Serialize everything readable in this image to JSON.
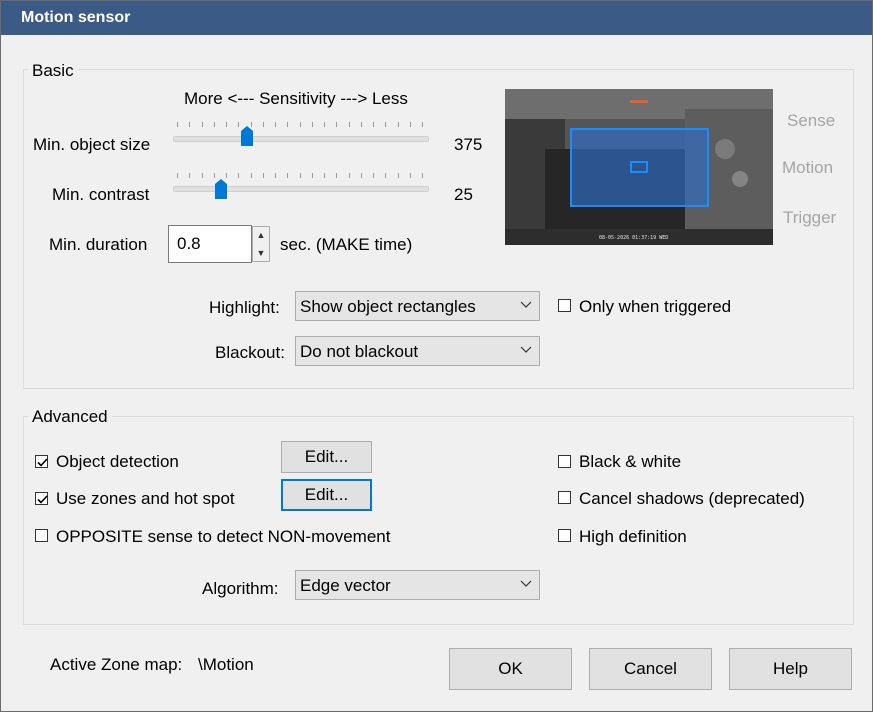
{
  "window": {
    "title": "Motion sensor"
  },
  "basic": {
    "group_label": "Basic",
    "sensitivity_label": "More <--- Sensitivity ---> Less",
    "min_object_size": {
      "label": "Min. object size",
      "value": "375",
      "level": 0.29
    },
    "min_contrast": {
      "label": "Min. contrast",
      "value": "25",
      "level": 0.19
    },
    "min_duration": {
      "label": "Min. duration",
      "value": "0.8",
      "unit": "sec.  (MAKE time)"
    },
    "highlight": {
      "label": "Highlight:",
      "selected": "Show object rectangles"
    },
    "only_when_triggered": {
      "label": "Only when triggered",
      "checked": false
    },
    "blackout": {
      "label": "Blackout:",
      "selected": "Do not blackout"
    },
    "preview": {
      "timestamp": "08-05-2026 01:37:19 WED",
      "side_labels": {
        "sense": "Sense",
        "motion": "Motion",
        "trigger": "Trigger"
      }
    }
  },
  "advanced": {
    "group_label": "Advanced",
    "object_detection": {
      "label": "Object detection",
      "checked": true,
      "edit_label": "Edit..."
    },
    "use_zones": {
      "label": "Use zones and hot spot",
      "checked": true,
      "edit_label": "Edit..."
    },
    "opposite_sense": {
      "label": "OPPOSITE sense to detect NON-movement",
      "checked": false
    },
    "black_white": {
      "label": "Black & white",
      "checked": false
    },
    "cancel_shadows": {
      "label": "Cancel shadows (deprecated)",
      "checked": false
    },
    "high_definition": {
      "label": "High definition",
      "checked": false
    },
    "algorithm": {
      "label": "Algorithm:",
      "selected": "Edge vector"
    }
  },
  "footer": {
    "zone_map_label": "Active Zone map:",
    "zone_map_value": "\\Motion",
    "ok_label": "OK",
    "cancel_label": "Cancel",
    "help_label": "Help"
  },
  "colors": {
    "titlebar": "#3c5a86",
    "accent": "#0078d7",
    "zone_fill": "#2f6fc8",
    "sense_bar": "#e0622c"
  },
  "icons": {
    "chevron": "chevron-down-icon",
    "spin_up": "caret-up-icon",
    "spin_down": "caret-down-icon",
    "check": "check-icon"
  }
}
